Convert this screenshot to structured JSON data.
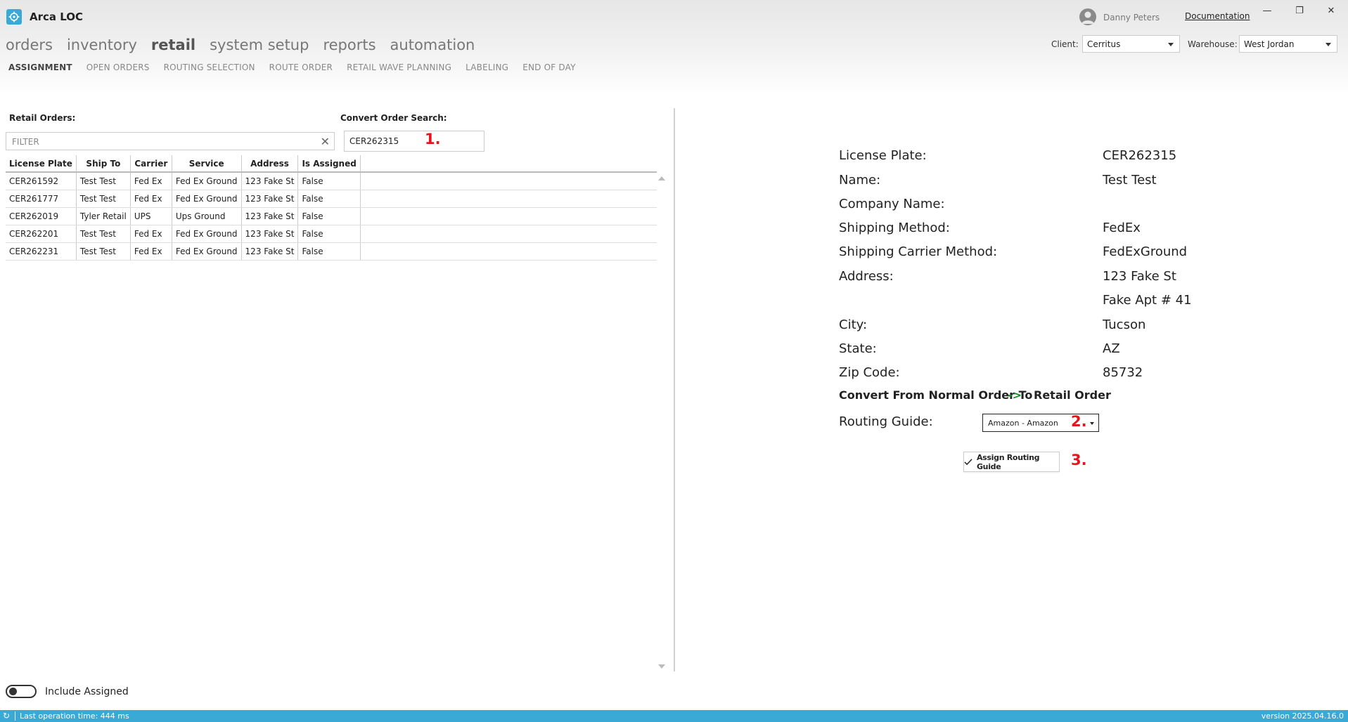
{
  "app": {
    "title": "Arca LOC",
    "logo_icon": "arca-logo-icon",
    "accent": "#3aa9d6"
  },
  "user": {
    "name": "Danny Peters",
    "documentation_label": "Documentation"
  },
  "window_controls": {
    "minimize": "—",
    "restore": "❐",
    "close": "✕"
  },
  "main_nav": [
    {
      "label": "orders",
      "active": false
    },
    {
      "label": "inventory",
      "active": false
    },
    {
      "label": "retail",
      "active": true
    },
    {
      "label": "system setup",
      "active": false
    },
    {
      "label": "reports",
      "active": false
    },
    {
      "label": "automation",
      "active": false
    }
  ],
  "sub_nav": [
    {
      "label": "ASSIGNMENT",
      "active": true
    },
    {
      "label": "OPEN ORDERS",
      "active": false
    },
    {
      "label": "ROUTING SELECTION",
      "active": false
    },
    {
      "label": "ROUTE ORDER",
      "active": false
    },
    {
      "label": "RETAIL WAVE PLANNING",
      "active": false
    },
    {
      "label": "LABELING",
      "active": false
    },
    {
      "label": "END OF DAY",
      "active": false
    }
  ],
  "client": {
    "label": "Client:",
    "value": "Cerritus"
  },
  "warehouse": {
    "label": "Warehouse:",
    "value": "West Jordan"
  },
  "retail_orders": {
    "label": "Retail Orders:",
    "filter_placeholder": "FILTER",
    "columns": [
      "License Plate",
      "Ship To",
      "Carrier",
      "Service",
      "Address",
      "Is Assigned"
    ],
    "rows": [
      [
        "CER261592",
        "Test Test",
        "Fed Ex",
        "Fed Ex Ground",
        "123 Fake St",
        "False"
      ],
      [
        "CER261777",
        "Test Test",
        "Fed Ex",
        "Fed Ex Ground",
        "123 Fake St",
        "False"
      ],
      [
        "CER262019",
        "Tyler Retail",
        "UPS",
        "Ups Ground",
        "123 Fake St",
        "False"
      ],
      [
        "CER262201",
        "Test Test",
        "Fed Ex",
        "Fed Ex Ground",
        "123 Fake St",
        "False"
      ],
      [
        "CER262231",
        "Test Test",
        "Fed Ex",
        "Fed Ex Ground",
        "123 Fake St",
        "False"
      ]
    ]
  },
  "convert_search": {
    "label": "Convert Order Search:",
    "value": "CER262315"
  },
  "markers": {
    "m1": "1.",
    "m2": "2.",
    "m3": "3.",
    "color": "#e8141b"
  },
  "details": [
    {
      "label": "License Plate:",
      "value": "CER262315"
    },
    {
      "label": "Name:",
      "value": "Test Test"
    },
    {
      "label": "Company Name:",
      "value": ""
    },
    {
      "label": "Shipping Method:",
      "value": "FedEx"
    },
    {
      "label": "Shipping Carrier Method:",
      "value": "FedExGround"
    },
    {
      "label": "Address:",
      "value": "123 Fake St"
    },
    {
      "label": "",
      "value": "Fake Apt # 41"
    },
    {
      "label": "City:",
      "value": "Tucson"
    },
    {
      "label": "State:",
      "value": "AZ"
    },
    {
      "label": "Zip Code:",
      "value": "85732"
    }
  ],
  "convert": {
    "from": "Convert From Normal Order To",
    "arrow": "->",
    "to": "Retail Order",
    "arrow_color": "#1a8a2a"
  },
  "routing_guide": {
    "label": "Routing Guide:",
    "value": "Amazon - Amazon"
  },
  "assign_button": {
    "label": "Assign Routing Guide",
    "icon": "checkmark-icon"
  },
  "include_assigned": {
    "label": "Include Assigned",
    "checked": false
  },
  "status": {
    "last_operation": "Last operation time:  444 ms",
    "version": "version 2025.04.16.0"
  }
}
